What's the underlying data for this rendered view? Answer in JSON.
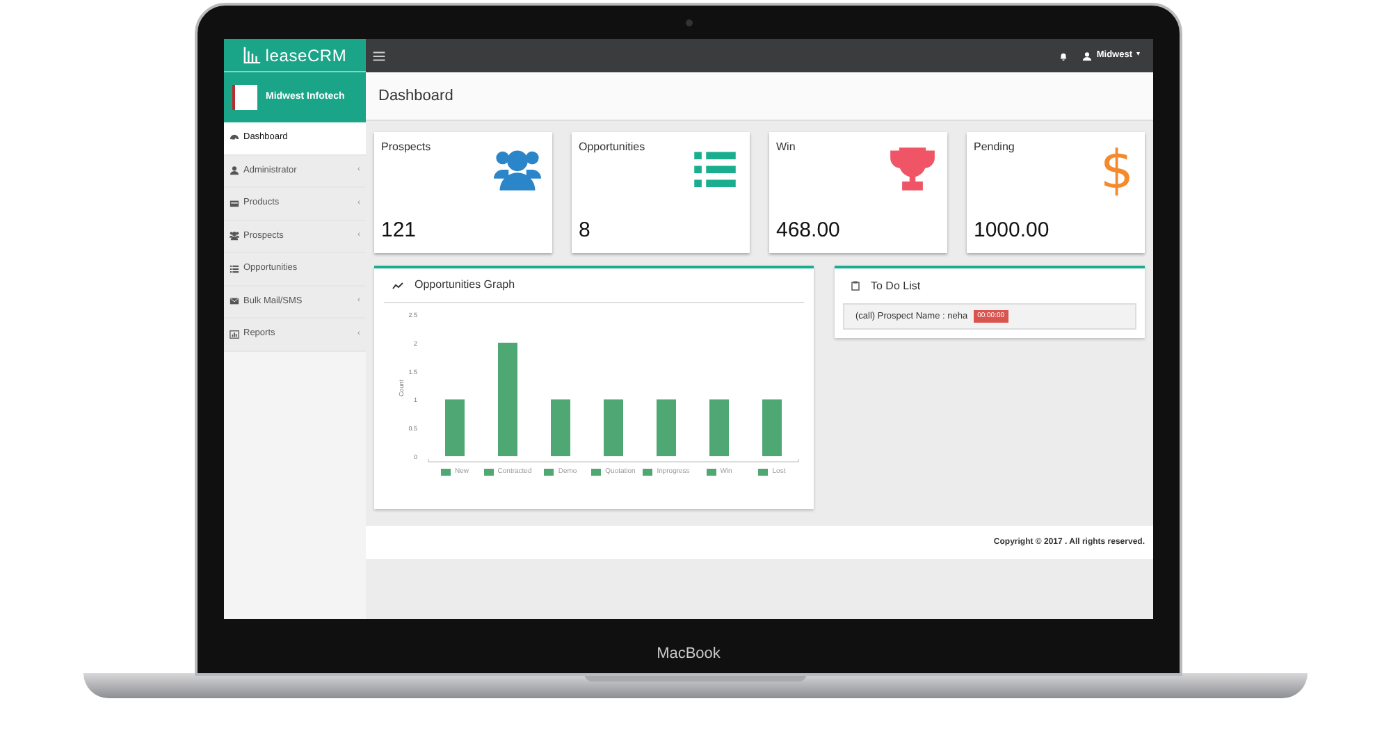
{
  "laptop": {
    "brand": "MacBook"
  },
  "app": {
    "logo": "leaseCRM",
    "company": "Midwest Infotech",
    "user": "Midwest",
    "user_caret": "▾"
  },
  "sidebar": {
    "items": [
      {
        "label": "Dashboard",
        "kind": "dashboard",
        "selected": true
      },
      {
        "label": "Administrator",
        "kind": "user",
        "selected": false,
        "chevron": "‹"
      },
      {
        "label": "Products",
        "kind": "card",
        "selected": false,
        "chevron": "‹"
      },
      {
        "label": "Prospects",
        "kind": "users",
        "selected": false,
        "chevron": "‹"
      },
      {
        "label": "Opportunities",
        "kind": "list",
        "selected": false
      },
      {
        "label": "Bulk Mail/SMS",
        "kind": "mail",
        "selected": false,
        "chevron": "‹"
      },
      {
        "label": "Reports",
        "kind": "chart",
        "selected": false,
        "chevron": "‹"
      }
    ]
  },
  "page_title": "Dashboard",
  "cards": [
    {
      "title": "Prospects",
      "value": "121",
      "kind": "users",
      "color": "#2a85c9"
    },
    {
      "title": "Opportunities",
      "value": "8",
      "kind": "list",
      "color": "#1aae8f"
    },
    {
      "title": "Win",
      "value": "468.00",
      "kind": "trophy",
      "color": "#ef5566"
    },
    {
      "title": "Pending",
      "value": "1000.00",
      "kind": "symbol",
      "symbol": "$",
      "color": "#f58a2c"
    }
  ],
  "graph": {
    "title": "Opportunities Graph",
    "chart_data": {
      "type": "bar",
      "ylabel": "Count",
      "categories": [
        "New",
        "Contracted",
        "Demo",
        "Quotation",
        "Inprogress",
        "Win",
        "Lost"
      ],
      "series": [
        {
          "color": "#4fa874",
          "values": [
            1,
            2,
            1,
            1,
            1,
            1,
            1
          ]
        }
      ],
      "ylim": [
        0,
        2.5
      ],
      "yticks": [
        0,
        0.5,
        1,
        1.5,
        2,
        2.5
      ]
    }
  },
  "todo": {
    "title": "To Do List",
    "items": [
      {
        "text": "(call) Prospect Name : neha",
        "badge": "00:00:00"
      }
    ]
  },
  "footer": "Copyright © 2017 . All rights reserved."
}
